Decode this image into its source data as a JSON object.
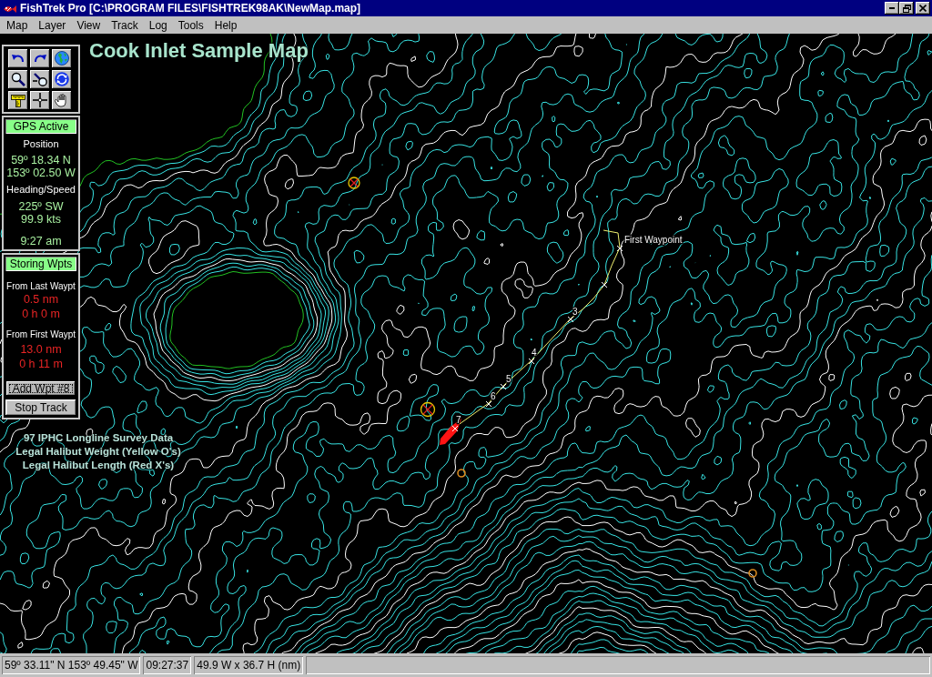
{
  "window": {
    "title": "FishTrek Pro [C:\\PROGRAM FILES\\FISHTREK98AK\\NewMap.map]"
  },
  "menu": [
    "Map",
    "Layer",
    "View",
    "Track",
    "Log",
    "Tools",
    "Help"
  ],
  "map": {
    "title": "Cook Inlet Sample Map",
    "waypoint_labels": [
      "First Waypoint",
      "3",
      "4",
      "5",
      "6",
      "7"
    ],
    "survey_markers": [
      {
        "kind": "weight_length"
      },
      {
        "kind": "weight_length"
      },
      {
        "kind": "weight"
      },
      {
        "kind": "weight"
      }
    ],
    "legend": [
      "97 IPHC Longline Survey Data",
      "Legal Halibut Weight (Yellow O's)",
      "Legal Halibut Length (Red X's)"
    ]
  },
  "gps": {
    "indicator": {
      "label": "GPS Active",
      "on": true
    },
    "position_label": "Position",
    "latitude": "59º 18.34 N",
    "longitude": "153º 02.50 W",
    "heading_label": "Heading/Speed",
    "heading": "225º SW",
    "speed": "99.9 kts",
    "time": "9:27 am"
  },
  "waypoints": {
    "indicator": {
      "label": "Storing Wpts",
      "on": true
    },
    "sections": [
      {
        "label": "From Last Waypt",
        "distance": "0.5 nm",
        "time": "0 h 0 m"
      },
      {
        "label": "From First Waypt",
        "distance": "13.0 nm",
        "time": "0 h 11 m"
      }
    ],
    "buttons": [
      {
        "label": "Add Wpt #8",
        "focused": true
      },
      {
        "label": "Stop Track",
        "focused": false
      }
    ]
  },
  "status_bar": [
    "59º 33.11\" N 153º 49.45\" W",
    "09:27:37",
    "49.9 W x 36.7 H (nm)"
  ]
}
